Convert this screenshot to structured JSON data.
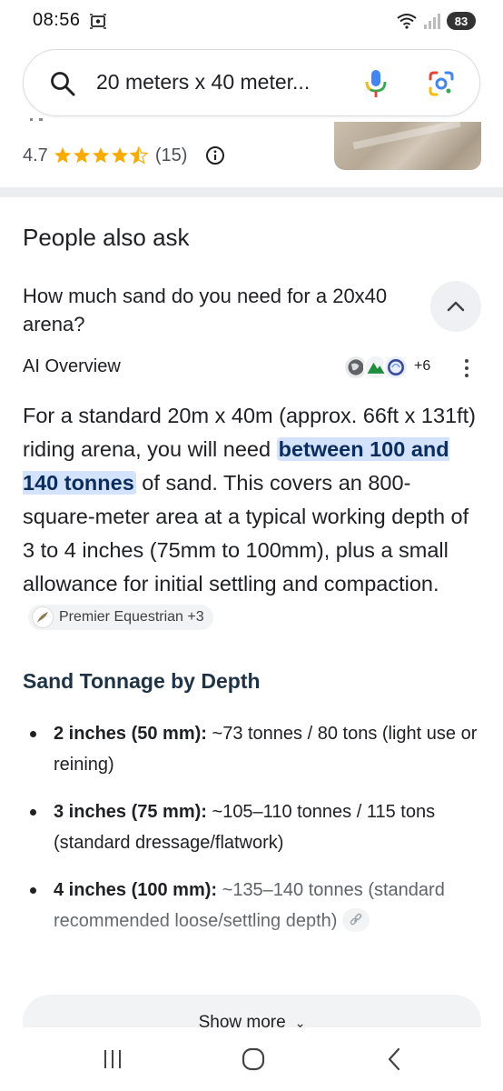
{
  "status_bar": {
    "time": "08:56",
    "battery": "83"
  },
  "search": {
    "query": "20 meters x 40 meter..."
  },
  "previous_result": {
    "rating": "4.7",
    "stars": 4.5,
    "review_count": "(15)"
  },
  "people_also_ask": {
    "title": "People also ask",
    "question": "How much sand do you need for a 20x40 arena?"
  },
  "ai_overview": {
    "label": "AI Overview",
    "more_sources": "+6",
    "text_1": "For a standard 20m x 40m (approx. 66ft x 131ft) riding arena, you will need ",
    "highlight": "between 100 and 140 tonnes",
    "text_2": " of sand. This covers an 800-square-meter area at a typical working depth of 3 to 4 inches (75mm to 100mm), plus a small allowance for initial settling and compaction.",
    "source_chip": "Premier Equestrian +3"
  },
  "section": {
    "heading": "Sand Tonnage by Depth",
    "items": [
      {
        "bold": "2 inches (50 mm):",
        "text": " ~73 tonnes / 80 tons (light use or reining)"
      },
      {
        "bold": "3 inches (75 mm):",
        "text": " ~105–110 tonnes / 115 tons (standard dressage/flatwork)"
      },
      {
        "bold": "4 inches (100 mm):",
        "text": " ~135–140 tonnes (standard recommended loose/settling depth)"
      }
    ]
  },
  "show_more": {
    "label": "Show more"
  },
  "icons": {
    "search": "search-icon",
    "mic": "mic-icon",
    "lens": "google-lens-icon",
    "info": "info-icon",
    "collapse": "chevron-up-icon",
    "kebab": "more-vert-icon",
    "link": "link-icon",
    "nav_recents": "recents-icon",
    "nav_home": "home-icon",
    "nav_back": "back-icon"
  },
  "colors": {
    "highlight_bg": "#d3e3fd",
    "star": "#f9ab00",
    "heading": "#1f3347"
  }
}
